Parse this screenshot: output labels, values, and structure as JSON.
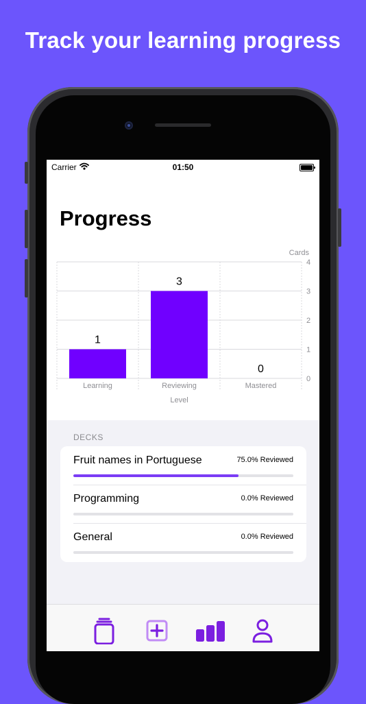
{
  "headline": "Track your learning progress",
  "status_bar": {
    "carrier": "Carrier",
    "time": "01:50"
  },
  "page_title": "Progress",
  "chart_data": {
    "type": "bar",
    "categories": [
      "Learning",
      "Reviewing",
      "Mastered"
    ],
    "values": [
      1,
      3,
      0
    ],
    "xlabel": "Level",
    "ylabel": "Cards",
    "ylim": [
      0,
      4
    ],
    "yticks": [
      "0",
      "1",
      "2",
      "3",
      "4"
    ],
    "data_labels": [
      "1",
      "3",
      "0"
    ],
    "bar_color": "#7000ff",
    "grid": true
  },
  "decks": {
    "section_label": "DECKS",
    "items": [
      {
        "name": "Fruit names in Portuguese",
        "status": "75.0% Reviewed",
        "progress": 0.75
      },
      {
        "name": "Programming",
        "status": "0.0% Reviewed",
        "progress": 0.0
      },
      {
        "name": "General",
        "status": "0.0% Reviewed",
        "progress": 0.0
      }
    ]
  },
  "tab_bar": {
    "accent": "#7b1fe0",
    "items": [
      {
        "icon": "card-stack-icon"
      },
      {
        "icon": "add-card-icon"
      },
      {
        "icon": "bar-chart-icon"
      },
      {
        "icon": "profile-icon"
      }
    ]
  },
  "colors": {
    "background": "#6c55fc",
    "accent": "#7000ff"
  }
}
